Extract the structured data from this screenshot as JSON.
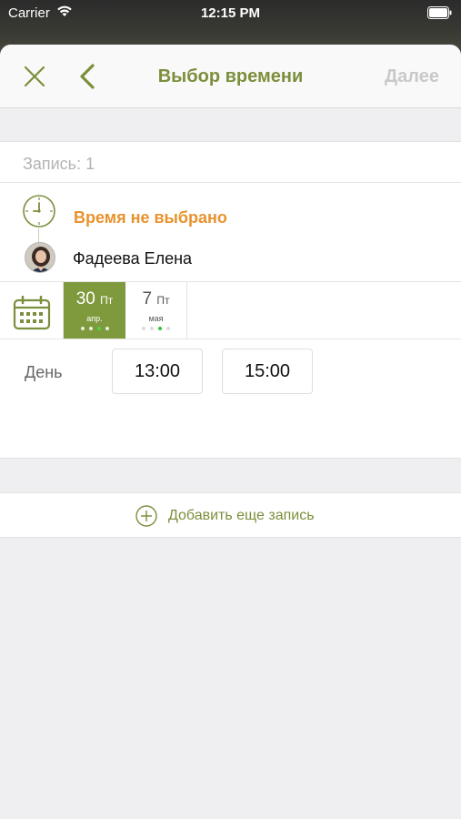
{
  "status_bar": {
    "carrier": "Carrier",
    "time": "12:15 PM"
  },
  "navbar": {
    "title": "Выбор времени",
    "next_label": "Далее"
  },
  "entry": {
    "label": "Запись: 1",
    "time_status": "Время не выбрано",
    "staff_name": "Фадеева Елена"
  },
  "dates": [
    {
      "day": "30",
      "weekday": "Пт",
      "month": "апр.",
      "selected": true
    },
    {
      "day": "7",
      "weekday": "Пт",
      "month": "мая",
      "selected": false
    }
  ],
  "time_slots": {
    "period": "День",
    "slots": [
      "13:00",
      "15:00"
    ]
  },
  "add_entry": {
    "label": "Добавить еще запись"
  },
  "colors": {
    "accent": "#7b8f3c",
    "selected_date_bg": "#7f9a3d",
    "warning": "#e8932d",
    "disabled": "#c9c9c9"
  }
}
